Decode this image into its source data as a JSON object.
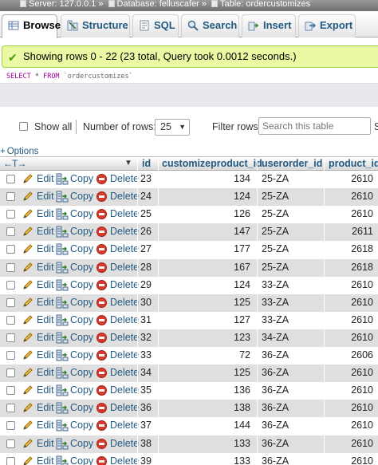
{
  "breadcrumb": {
    "server": "Server: 127.0.0.1",
    "database": "Database: felluscafer",
    "table": "Table: ordercustomizes"
  },
  "tabs": [
    {
      "label": "Browse",
      "icon": "table-icon",
      "active": true
    },
    {
      "label": "Structure",
      "icon": "structure-icon",
      "active": false
    },
    {
      "label": "SQL",
      "icon": "sql-icon",
      "active": false
    },
    {
      "label": "Search",
      "icon": "search-icon",
      "active": false
    },
    {
      "label": "Insert",
      "icon": "insert-icon",
      "active": false
    },
    {
      "label": "Export",
      "icon": "export-icon",
      "active": false
    }
  ],
  "message": "Showing rows 0 - 22 (23 total, Query took 0.0012 seconds.)",
  "sql": {
    "select": "SELECT",
    "rest": " * ",
    "from": "FROM",
    "table": " `ordercustomizes`"
  },
  "navigation": {
    "show_all": "Show all",
    "rows_label": "Number of rows:",
    "rows_value": "25",
    "filter_label": "Filter rows:",
    "search_placeholder": "Search this table",
    "truncated": "S"
  },
  "options_label": "Options",
  "columns": [
    "id",
    "customizeproduct_id",
    "userorder_id",
    "product_id"
  ],
  "actions": {
    "edit": "Edit",
    "copy": "Copy",
    "delete": "Delete"
  },
  "rows": [
    {
      "id": "23",
      "customizeproduct_id": "134",
      "userorder_id": "25-ZA",
      "product_id": "2610"
    },
    {
      "id": "24",
      "customizeproduct_id": "124",
      "userorder_id": "25-ZA",
      "product_id": "2610"
    },
    {
      "id": "25",
      "customizeproduct_id": "126",
      "userorder_id": "25-ZA",
      "product_id": "2610"
    },
    {
      "id": "26",
      "customizeproduct_id": "147",
      "userorder_id": "25-ZA",
      "product_id": "2611"
    },
    {
      "id": "27",
      "customizeproduct_id": "177",
      "userorder_id": "25-ZA",
      "product_id": "2618"
    },
    {
      "id": "28",
      "customizeproduct_id": "167",
      "userorder_id": "25-ZA",
      "product_id": "2618"
    },
    {
      "id": "29",
      "customizeproduct_id": "124",
      "userorder_id": "33-ZA",
      "product_id": "2610"
    },
    {
      "id": "30",
      "customizeproduct_id": "125",
      "userorder_id": "33-ZA",
      "product_id": "2610"
    },
    {
      "id": "31",
      "customizeproduct_id": "127",
      "userorder_id": "33-ZA",
      "product_id": "2610"
    },
    {
      "id": "32",
      "customizeproduct_id": "123",
      "userorder_id": "34-ZA",
      "product_id": "2610"
    },
    {
      "id": "33",
      "customizeproduct_id": "72",
      "userorder_id": "36-ZA",
      "product_id": "2606"
    },
    {
      "id": "34",
      "customizeproduct_id": "125",
      "userorder_id": "36-ZA",
      "product_id": "2610"
    },
    {
      "id": "35",
      "customizeproduct_id": "136",
      "userorder_id": "36-ZA",
      "product_id": "2610"
    },
    {
      "id": "36",
      "customizeproduct_id": "138",
      "userorder_id": "36-ZA",
      "product_id": "2610"
    },
    {
      "id": "37",
      "customizeproduct_id": "144",
      "userorder_id": "36-ZA",
      "product_id": "2610"
    },
    {
      "id": "38",
      "customizeproduct_id": "133",
      "userorder_id": "36-ZA",
      "product_id": "2610"
    },
    {
      "id": "39",
      "customizeproduct_id": "133",
      "userorder_id": "36-ZA",
      "product_id": "2610"
    }
  ]
}
